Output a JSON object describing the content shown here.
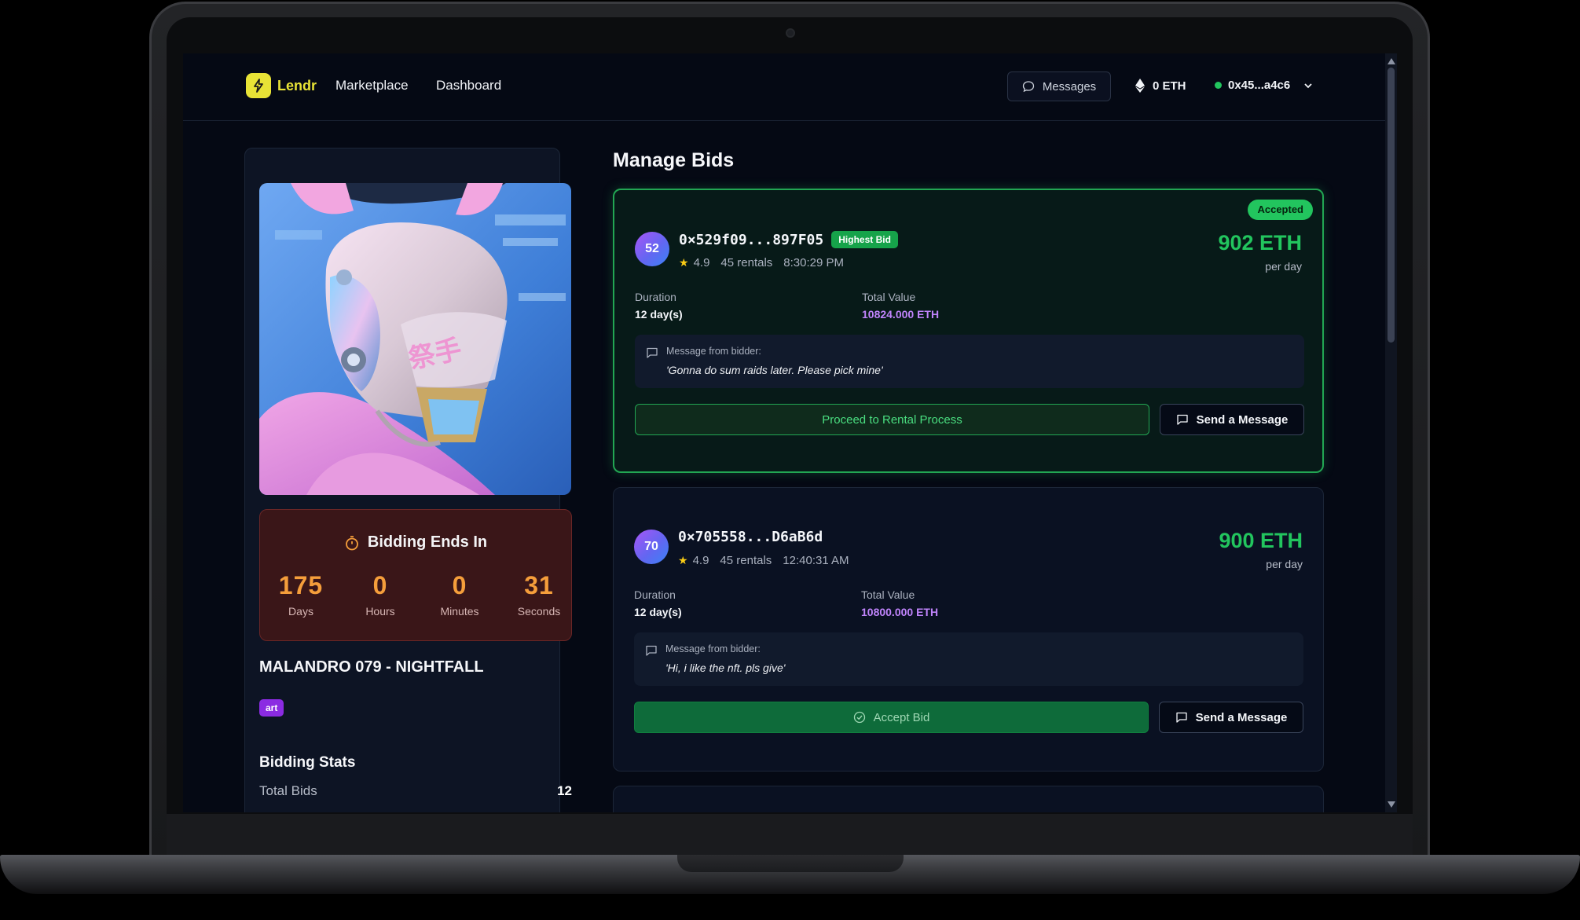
{
  "nav": {
    "brand": "Lendr",
    "links": [
      "Marketplace",
      "Dashboard"
    ],
    "messages_label": "Messages",
    "eth_balance": "0 ETH",
    "wallet": "0x45...a4c6"
  },
  "nft": {
    "countdown_title": "Bidding Ends In",
    "countdown": [
      {
        "value": "175",
        "label": "Days"
      },
      {
        "value": "0",
        "label": "Hours"
      },
      {
        "value": "0",
        "label": "Minutes"
      },
      {
        "value": "31",
        "label": "Seconds"
      }
    ],
    "title": "MALANDRO 079 - NIGHTFALL",
    "tag": "art",
    "stats_title": "Bidding Stats",
    "stats": [
      {
        "label": "Total Bids",
        "value": "12"
      }
    ]
  },
  "main": {
    "heading": "Manage Bids",
    "bids": [
      {
        "status": "Accepted",
        "avatar": "52",
        "address": "0×529f09...897F05",
        "highest_badge": "Highest Bid",
        "rating": "4.9",
        "rentals": "45 rentals",
        "time": "8:30:29 PM",
        "price": "902 ETH",
        "price_unit": "per day",
        "duration_label": "Duration",
        "duration": "12 day(s)",
        "total_label": "Total Value",
        "total": "10824.000 ETH",
        "message_label": "Message from bidder:",
        "message": "'Gonna do sum raids later. Please pick mine'",
        "primary_action": "Proceed to Rental Process",
        "secondary_action": "Send a Message"
      },
      {
        "avatar": "70",
        "address": "0×705558...D6aB6d",
        "rating": "4.9",
        "rentals": "45 rentals",
        "time": "12:40:31 AM",
        "price": "900 ETH",
        "price_unit": "per day",
        "duration_label": "Duration",
        "duration": "12 day(s)",
        "total_label": "Total Value",
        "total": "10800.000 ETH",
        "message_label": "Message from bidder:",
        "message": "'Hi, i like the nft. pls give'",
        "primary_action": "Accept Bid",
        "secondary_action": "Send a Message"
      }
    ]
  },
  "colors": {
    "accent_yellow": "#e8e336",
    "success_green": "#22c55e",
    "price_purple": "#c084fc",
    "countdown_orange": "#f59e3b"
  }
}
